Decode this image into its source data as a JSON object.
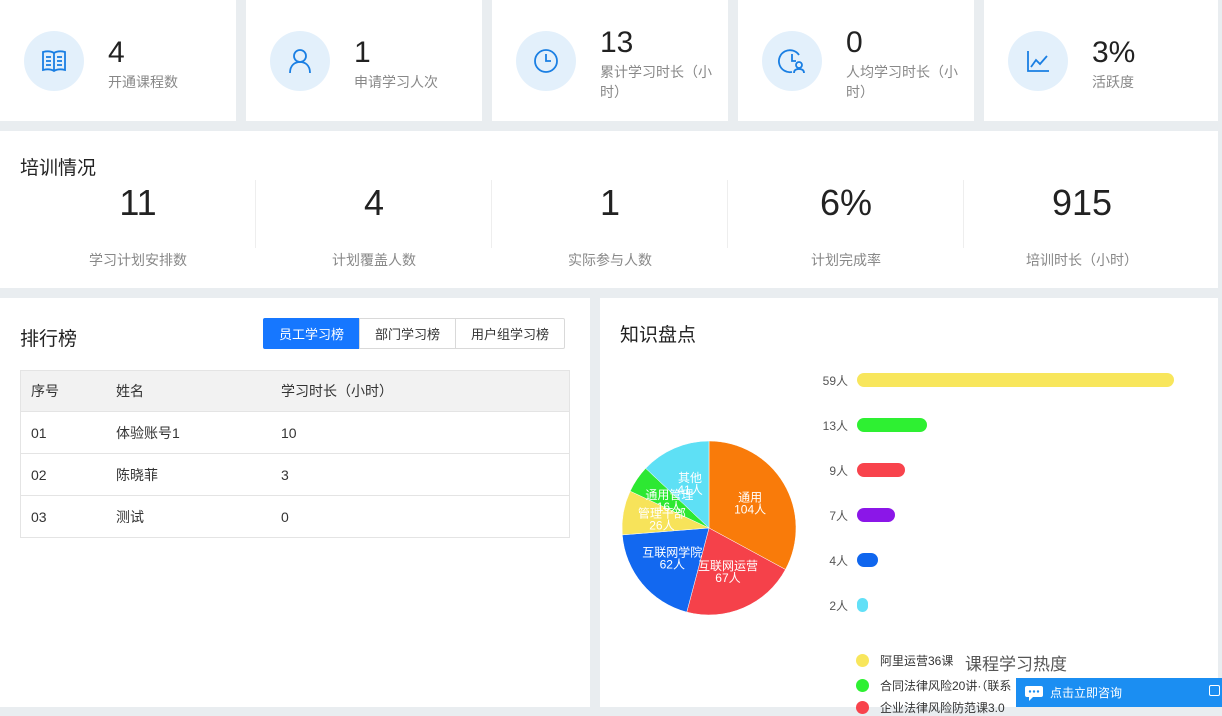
{
  "stats": [
    {
      "value": "4",
      "label": "开通课程数",
      "icon": "book-icon"
    },
    {
      "value": "1",
      "label": "申请学习人次",
      "icon": "user-icon"
    },
    {
      "value": "13",
      "label": "累计学习时长（小时）",
      "icon": "clock-icon"
    },
    {
      "value": "0",
      "label": "人均学习时长（小时）",
      "icon": "clock-user-icon"
    },
    {
      "value": "3%",
      "label": "活跃度",
      "icon": "line-chart-icon"
    }
  ],
  "training": {
    "title": "培训情况",
    "items": [
      {
        "value": "11",
        "label": "学习计划安排数"
      },
      {
        "value": "4",
        "label": "计划覆盖人数"
      },
      {
        "value": "1",
        "label": "实际参与人数"
      },
      {
        "value": "6%",
        "label": "计划完成率"
      },
      {
        "value": "915",
        "label": "培训时长（小时）"
      }
    ]
  },
  "ranking": {
    "title": "排行榜",
    "tabs": [
      "员工学习榜",
      "部门学习榜",
      "用户组学习榜"
    ],
    "active_tab": 0,
    "columns": [
      "序号",
      "姓名",
      "学习时长（小时）"
    ],
    "rows": [
      [
        "01",
        "体验账号1",
        "10"
      ],
      [
        "02",
        "陈晓菲",
        "3"
      ],
      [
        "03",
        "测试",
        "0"
      ]
    ]
  },
  "knowledge": {
    "title": "知识盘点",
    "bar_chart_title": "课程学习热度",
    "pie_labels": [
      {
        "name": "通用",
        "value": "104人"
      },
      {
        "name": "互联网运营",
        "value": "67人"
      },
      {
        "name": "互联网学院",
        "value": "62人"
      },
      {
        "name": "管理干部",
        "value": "26人"
      },
      {
        "name": "通用管理",
        "value": "16人"
      },
      {
        "name": "其他",
        "value": "41人"
      }
    ],
    "legend": [
      "阿里运营36课",
      "合同法律风险20讲·（联系",
      "企业法律风险防范课3.0"
    ]
  },
  "chart_data": [
    {
      "type": "pie",
      "labels": [
        "通用",
        "互联网运营",
        "互联网学院",
        "管理干部",
        "通用管理",
        "其他"
      ],
      "values": [
        104,
        67,
        62,
        26,
        16,
        41
      ],
      "colors": [
        "#f97b0a",
        "#f5414a",
        "#1268f0",
        "#f7e35a",
        "#2de832",
        "#5ee0f5"
      ]
    },
    {
      "type": "bar",
      "title": "课程学习热度",
      "categories": [
        "阿里运营36课",
        "合同法律风险20讲·（联系",
        "企业法律风险防范课3.0",
        "",
        "",
        ""
      ],
      "values": [
        59,
        13,
        9,
        7,
        4,
        2
      ],
      "value_labels": [
        "59人",
        "13人",
        "9人",
        "7人",
        "4人",
        "2人"
      ],
      "colors": [
        "#f8e65c",
        "#2ef032",
        "#f8434c",
        "#8b16e8",
        "#1066ee",
        "#62e0f7"
      ]
    }
  ],
  "chat": {
    "label": "点击立即咨询"
  }
}
